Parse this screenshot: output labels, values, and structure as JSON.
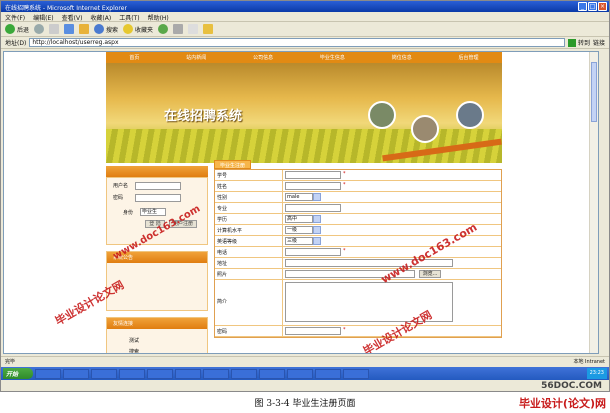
{
  "window": {
    "title": "在线招聘系统 - Microsoft Internet Explorer"
  },
  "menubar": [
    "文件(F)",
    "编辑(E)",
    "查看(V)",
    "收藏(A)",
    "工具(T)",
    "帮助(H)"
  ],
  "toolbar": {
    "back": "后退",
    "search": "搜索",
    "favorites": "收藏夹"
  },
  "address": {
    "label": "地址(D)",
    "url": "http://localhost/userreg.aspx",
    "go": "转到",
    "links": "链接"
  },
  "site": {
    "nav": [
      "首页",
      "站内新闻",
      "公司信息",
      "毕业生信息",
      "岗位信息",
      "后台管理"
    ],
    "banner_title": "在线招聘系统",
    "login": {
      "user_label": "用户名",
      "pass_label": "密码",
      "identity_label": "身份",
      "identity_value": "毕业生",
      "login_btn": "登 陆",
      "register_btn": "用户注册"
    },
    "notice_title": "系统公告",
    "links_title": "友情连接",
    "links": [
      "测试",
      "搜索"
    ],
    "form_tab": "毕业生注册",
    "form_rows": [
      {
        "label": "学号",
        "value": "",
        "required": "*"
      },
      {
        "label": "姓名",
        "value": "",
        "required": "*"
      },
      {
        "label": "性别",
        "value": "male"
      },
      {
        "label": "专业",
        "value": ""
      },
      {
        "label": "学历",
        "value": "高中"
      },
      {
        "label": "计算机水平",
        "value": "一级"
      },
      {
        "label": "英语等级",
        "value": "三级"
      },
      {
        "label": "电话",
        "value": "",
        "required": "*"
      },
      {
        "label": "地址",
        "value": ""
      },
      {
        "label": "照片",
        "value": "",
        "browse": "浏览..."
      },
      {
        "label": "简介",
        "value": ""
      },
      {
        "label": "密码",
        "value": "",
        "required": "*"
      }
    ]
  },
  "status": {
    "left": "完毕",
    "right": "本地 Intranet"
  },
  "taskbar": {
    "start": "开始",
    "time": "23:23"
  },
  "watermarks": [
    "毕业设计论文网",
    "www.doc163.com"
  ],
  "caption": "图 3-3-4 毕业生注册页面",
  "footer_site": "56DOC.COM",
  "footer_logo": "毕业设计(论文)网"
}
